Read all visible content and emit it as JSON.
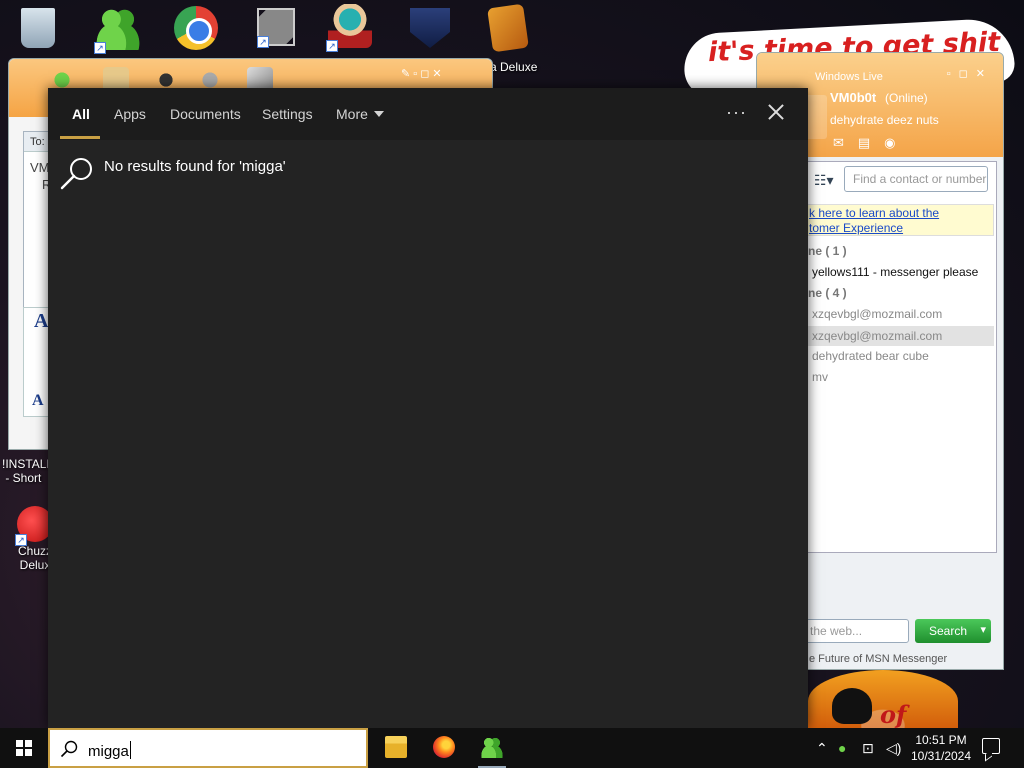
{
  "desktop": {
    "icons": [
      {
        "name": "Recycle Bin",
        "label": ""
      },
      {
        "name": "Windows Live Messenger",
        "label": ""
      },
      {
        "name": "Google Chrome",
        "label": ""
      },
      {
        "name": "Shortcut",
        "label": ""
      },
      {
        "name": "Game",
        "label": ""
      },
      {
        "name": "Shield game",
        "label": ""
      },
      {
        "name": "Bandicoot Deluxe",
        "label": "a Deluxe"
      },
      {
        "name": "Install shortcut",
        "label": "!INSTALL\n - Short"
      },
      {
        "name": "Chuzzle Deluxe",
        "label": "Chuzz\nDelux"
      }
    ],
    "wallpaper_text": "it's time to get shit",
    "wallpaper_text_2": "of"
  },
  "msn_chat": {
    "to_label": "To:",
    "contact_partial": "VM",
    "letter_r": "R",
    "font_glyph": "A",
    "font_glyph_small": "A"
  },
  "msn_list": {
    "title": "Windows Live",
    "display_name": "VM0b0t",
    "status": "(Online)",
    "personal_message": "dehydrate deez nuts",
    "contact_search_placeholder": "Find a contact or number",
    "notice_line1": "k here to learn about the",
    "notice_line2": "tomer Experience",
    "groups": [
      {
        "label": "ne ( 1 )"
      },
      {
        "label": "ne ( 4 )"
      }
    ],
    "contacts": [
      {
        "text": "yellows111 - messenger please",
        "online": true
      },
      {
        "text": "xzqevbgl@mozmail.com",
        "online": false
      },
      {
        "text": "xzqevbgl@mozmail.com",
        "online": false,
        "selected": true
      },
      {
        "text": "dehydrated bear cube",
        "online": false
      },
      {
        "text": "mv",
        "online": false
      }
    ],
    "web_search_placeholder": "the web...",
    "search_button": "Search",
    "footer": "e Future of MSN Messenger"
  },
  "search_panel": {
    "tabs": [
      "All",
      "Apps",
      "Documents",
      "Settings",
      "More"
    ],
    "active_tab": "All",
    "more_menu_icon": "ellipsis-icon",
    "close_icon": "close-icon",
    "no_results_text": "No results found for 'migga'"
  },
  "taskbar": {
    "search_query": "migga",
    "pinned": [
      "File Explorer",
      "Firefox",
      "Windows Live Messenger"
    ],
    "time": "10:51 PM",
    "date": "10/31/2024"
  },
  "colors": {
    "accent": "#c9a044",
    "panel_bg": "#1f1f1f",
    "msn_orange": "#f5a444"
  }
}
